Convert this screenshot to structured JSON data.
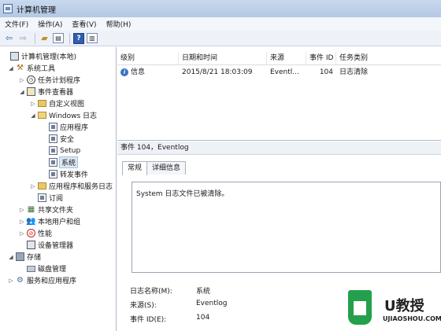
{
  "window": {
    "title": "计算机管理"
  },
  "menubar": {
    "items": [
      "文件(F)",
      "操作(A)",
      "查看(V)",
      "帮助(H)"
    ]
  },
  "tree": {
    "root": "计算机管理(本地)",
    "system_tools": "系统工具",
    "task_scheduler": "任务计划程序",
    "event_viewer": "事件查看器",
    "custom_views": "自定义视图",
    "windows_logs": "Windows 日志",
    "application": "应用程序",
    "security": "安全",
    "setup": "Setup",
    "system": "系统",
    "forwarded": "转发事件",
    "app_service_logs": "应用程序和服务日志",
    "subscriptions": "订阅",
    "shared_folders": "共享文件夹",
    "local_users": "本地用户和组",
    "performance": "性能",
    "device_manager": "设备管理器",
    "storage": "存储",
    "disk_management": "磁盘管理",
    "services_apps": "服务和应用程序"
  },
  "events": {
    "columns": [
      "级别",
      "日期和时间",
      "来源",
      "事件 ID",
      "任务类别"
    ],
    "rows": [
      {
        "level": "信息",
        "datetime": "2015/8/21 18:03:09",
        "source": "Eventl...",
        "event_id": "104",
        "category": "日志清除"
      }
    ]
  },
  "detail": {
    "title": "事件 104，Eventlog",
    "tabs": [
      "常规",
      "详细信息"
    ],
    "message": "System 日志文件已被清除。",
    "props": {
      "log_name_label": "日志名称(M):",
      "log_name_value": "系统",
      "source_label": "来源(S):",
      "source_value": "Eventlog",
      "event_id_label": "事件 ID(E):",
      "event_id_value": "104"
    }
  },
  "watermark": {
    "brand": "U教授",
    "url": "UJIAOSHOU.COM"
  }
}
